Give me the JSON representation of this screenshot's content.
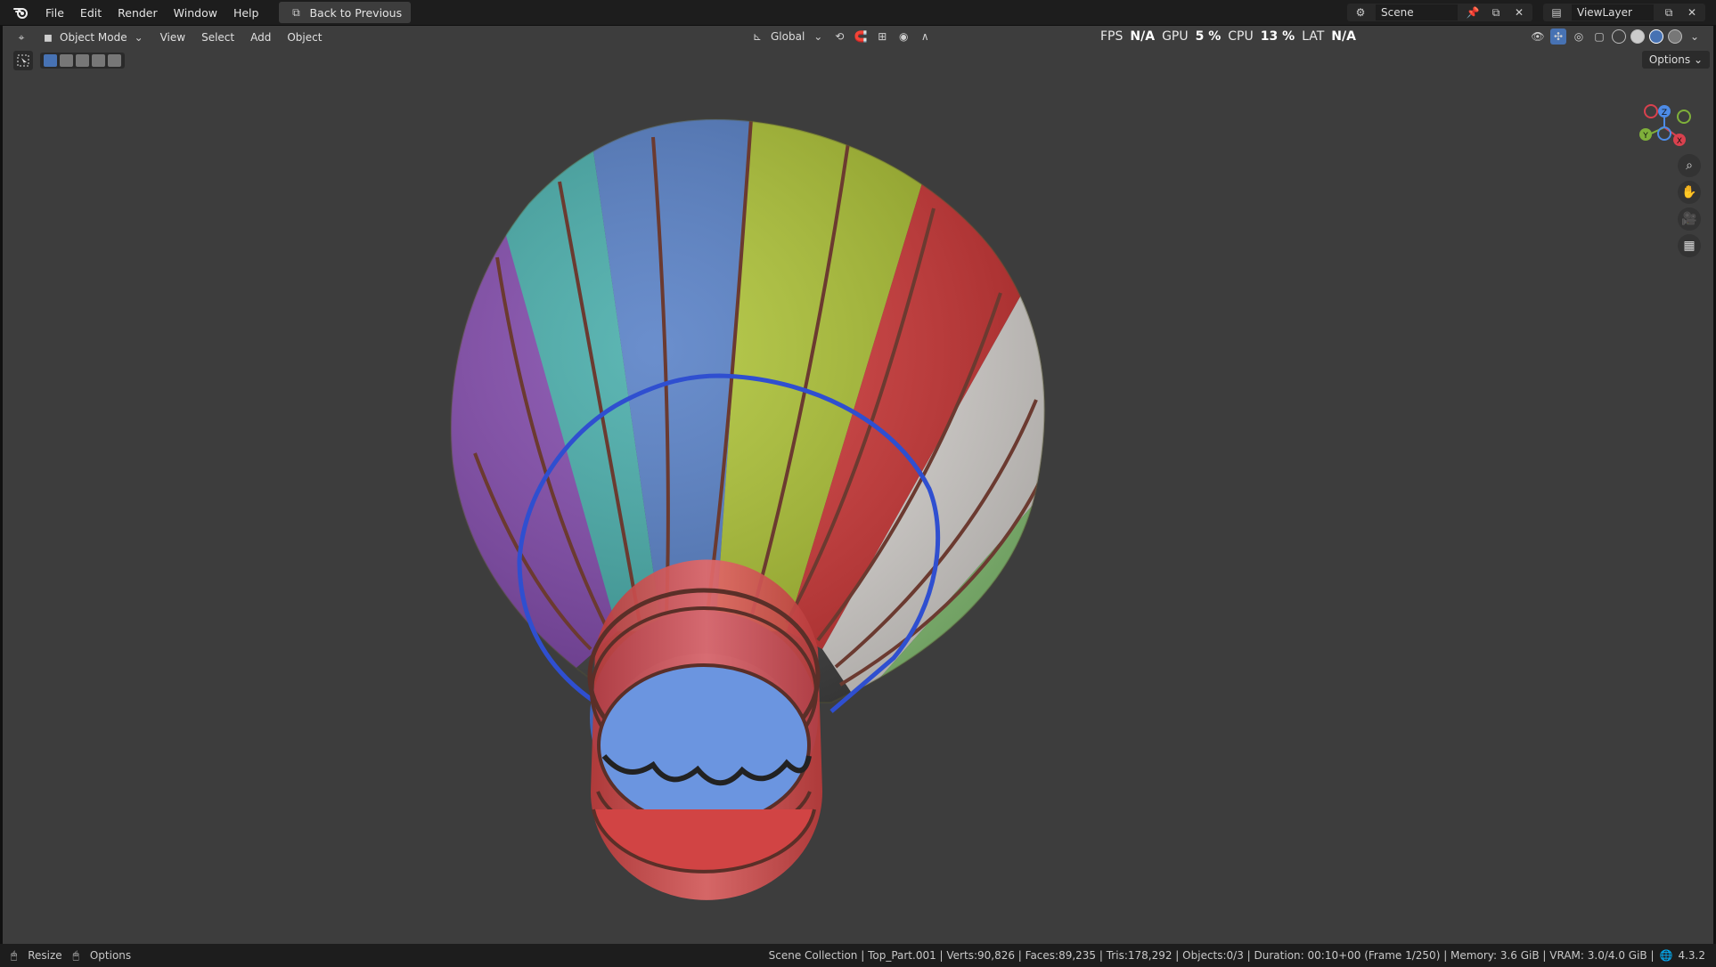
{
  "topbar": {
    "menus": [
      "File",
      "Edit",
      "Render",
      "Window",
      "Help"
    ],
    "back_button": "Back to Previous",
    "scene": "Scene",
    "view_layer": "ViewLayer"
  },
  "viewport_header": {
    "mode": "Object Mode",
    "menus": [
      "View",
      "Select",
      "Add",
      "Object"
    ],
    "transform_orientation": "Global",
    "options": "Options"
  },
  "stats": {
    "fps_label": "FPS",
    "fps": "N/A",
    "gpu_label": "GPU",
    "gpu": "5 %",
    "cpu_label": "CPU",
    "cpu": "13 %",
    "lat_label": "LAT",
    "lat": "N/A"
  },
  "gizmo": {
    "x": "X",
    "y": "Y",
    "z": "Z"
  },
  "statusbar": {
    "resize": "Resize",
    "options": "Options",
    "info": "Scene Collection | Top_Part.001 | Verts:90,826 | Faces:89,235 | Tris:178,292 | Objects:0/3 | Duration: 00:10+00 (Frame 1/250) | Memory: 3.6 GiB | VRAM: 3.0/4.0 GiB |",
    "version": "4.3.2"
  },
  "colors": {
    "viewport_bg": "#3d3d3d",
    "header_bg": "#1d1d1d",
    "accent": "#4772b3"
  }
}
